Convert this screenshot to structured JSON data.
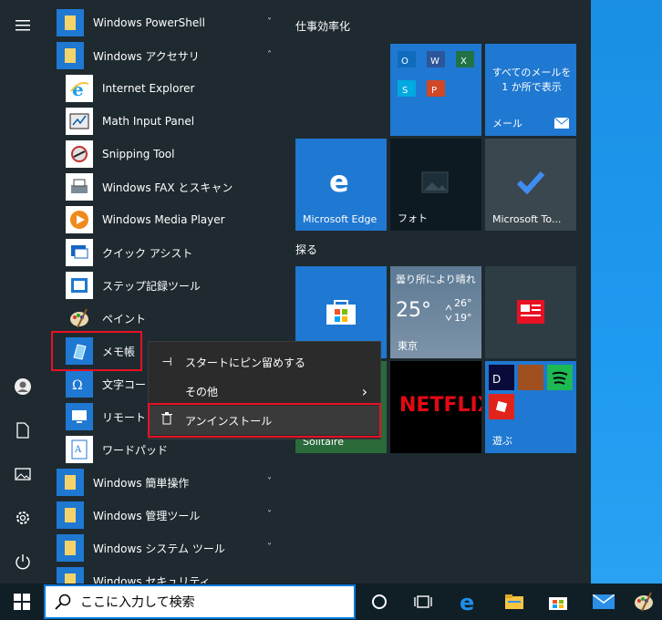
{
  "start_menu": {
    "rail": {
      "menu_icon": "hamburger-icon",
      "bottom_items": [
        "user-icon",
        "document-icon",
        "pictures-icon",
        "settings-icon",
        "power-icon"
      ]
    },
    "apps": [
      {
        "label": "Windows PowerShell",
        "kind": "folder",
        "chevron": "˅"
      },
      {
        "label": "Windows アクセサリ",
        "kind": "folder",
        "chevron": "˄"
      },
      {
        "label": "Internet Explorer",
        "kind": "app"
      },
      {
        "label": "Math Input Panel",
        "kind": "app"
      },
      {
        "label": "Snipping Tool",
        "kind": "app"
      },
      {
        "label": "Windows FAX とスキャン",
        "kind": "app"
      },
      {
        "label": "Windows Media Player",
        "kind": "app"
      },
      {
        "label": "クイック アシスト",
        "kind": "app"
      },
      {
        "label": "ステップ記録ツール",
        "kind": "app"
      },
      {
        "label": "ペイント",
        "kind": "app"
      },
      {
        "label": "メモ帳",
        "kind": "app"
      },
      {
        "label": "文字コード",
        "kind": "app"
      },
      {
        "label": "リモート デ",
        "kind": "app"
      },
      {
        "label": "ワードパッド",
        "kind": "app"
      },
      {
        "label": "Windows 簡単操作",
        "kind": "folder",
        "chevron": "˅"
      },
      {
        "label": "Windows 管理ツール",
        "kind": "folder",
        "chevron": "˅"
      },
      {
        "label": "Windows システム ツール",
        "kind": "folder",
        "chevron": "˅"
      },
      {
        "label": "Windows セキュリティ",
        "kind": "folder"
      }
    ],
    "groups": {
      "productivity": "仕事効率化",
      "explore": "探る"
    },
    "tiles": {
      "mail_text": "すべてのメールを 1 か所で表示",
      "mail_label": "メール",
      "edge_label": "Microsoft Edge",
      "photos_label": "フォト",
      "todo_label": "Microsoft To...",
      "weather_condition": "曇り所により晴れ",
      "weather_temp": "25°",
      "weather_high": "26°",
      "weather_low": "19°",
      "weather_city": "東京",
      "netflix_label": "NETFLIX",
      "solitaire_label": "Solitaire",
      "play_label": "遊ぶ"
    },
    "context_menu": {
      "pin_label": "スタートにピン留めする",
      "more_label": "その他",
      "uninstall_label": "アンインストール",
      "more_chevron": "›"
    }
  },
  "taskbar": {
    "search_placeholder": "ここに入力して検索",
    "icons": [
      "windows-start-icon",
      "search-icon",
      "cortana-icon",
      "task-view-icon",
      "edge-icon",
      "file-explorer-icon",
      "store-icon",
      "mail-icon",
      "paint-icon"
    ]
  },
  "colors": {
    "accent": "#0078d7",
    "highlight": "#e81123",
    "background": "#1e2a30"
  }
}
